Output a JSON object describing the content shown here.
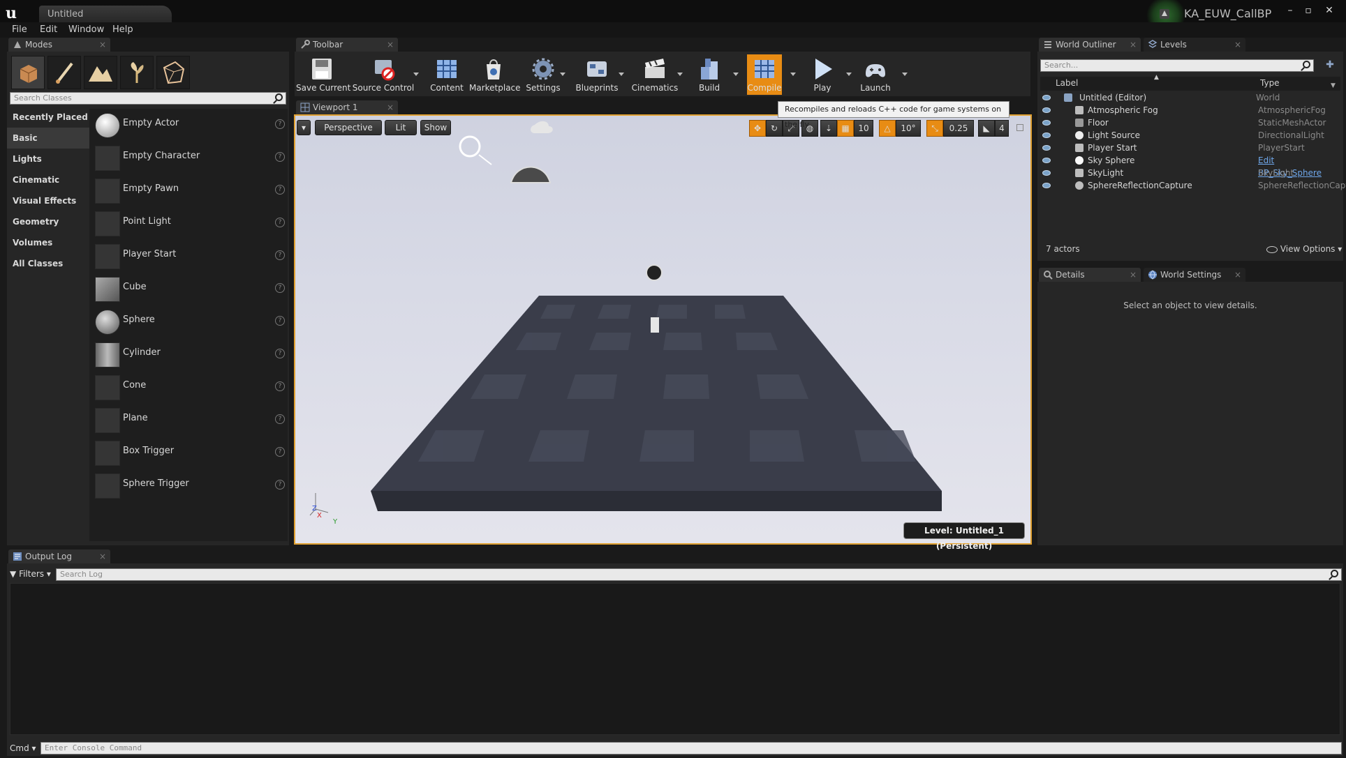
{
  "window": {
    "tab_title": "Untitled",
    "project_name": "KA_EUW_CallBP",
    "minimize": "–",
    "maximize": "▫",
    "close": "✕"
  },
  "menu": [
    "File",
    "Edit",
    "Window",
    "Help"
  ],
  "modes_panel": {
    "tab_label": "Modes",
    "mode_icons": [
      "place-mode-icon",
      "paint-mode-icon",
      "landscape-mode-icon",
      "foliage-mode-icon",
      "geometry-edit-mode-icon"
    ],
    "search_placeholder": "Search Classes",
    "categories": [
      "Recently Placed",
      "Basic",
      "Lights",
      "Cinematic",
      "Visual Effects",
      "Geometry",
      "Volumes",
      "All Classes"
    ],
    "active_category": "Basic",
    "items": [
      "Empty Actor",
      "Empty Character",
      "Empty Pawn",
      "Point Light",
      "Player Start",
      "Cube",
      "Sphere",
      "Cylinder",
      "Cone",
      "Plane",
      "Box Trigger",
      "Sphere Trigger"
    ],
    "help_glyph": "?"
  },
  "toolbar": {
    "tab_label": "Toolbar",
    "buttons": [
      {
        "label": "Save Current",
        "icon": "save-icon"
      },
      {
        "label": "Source Control",
        "icon": "source-control-icon"
      },
      {
        "label": "Content",
        "icon": "content-icon"
      },
      {
        "label": "Marketplace",
        "icon": "marketplace-icon"
      },
      {
        "label": "Settings",
        "icon": "settings-icon"
      },
      {
        "label": "Blueprints",
        "icon": "blueprints-icon"
      },
      {
        "label": "Cinematics",
        "icon": "cinematics-icon"
      },
      {
        "label": "Build",
        "icon": "build-icon"
      },
      {
        "label": "Compile",
        "icon": "compile-icon"
      },
      {
        "label": "Play",
        "icon": "play-icon"
      },
      {
        "label": "Launch",
        "icon": "launch-icon"
      }
    ],
    "tooltip": "Recompiles and reloads C++ code for game systems on the fly"
  },
  "viewport": {
    "tab_label": "Viewport 1",
    "perspective": "Perspective",
    "lit": "Lit",
    "show": "Show",
    "grid_snap": "10",
    "rotation_snap": "10°",
    "scale_snap": "0.25",
    "camera_speed": "4",
    "level_label": "Level:  Untitled_1 (Persistent)",
    "axis_labels": {
      "z": "Z",
      "x": "X",
      "y": "Y"
    },
    "accent": "#e88c14"
  },
  "world_outliner": {
    "tab_label": "World Outliner",
    "levels_tab": "Levels",
    "search_placeholder": "Search...",
    "columns": [
      "Label",
      "Type"
    ],
    "rows": [
      {
        "label": "Untitled (Editor)",
        "type": "World",
        "link": false
      },
      {
        "label": "Atmospheric Fog",
        "type": "AtmosphericFog",
        "link": false
      },
      {
        "label": "Floor",
        "type": "StaticMeshActor",
        "link": false
      },
      {
        "label": "Light Source",
        "type": "DirectionalLight",
        "link": false
      },
      {
        "label": "Player Start",
        "type": "PlayerStart",
        "link": false
      },
      {
        "label": "Sky Sphere",
        "type": "Edit BP_Sky_Sphere",
        "link": true
      },
      {
        "label": "SkyLight",
        "type": "SkyLight",
        "link": false
      },
      {
        "label": "SphereReflectionCapture",
        "type": "SphereReflectionCapt",
        "link": false
      }
    ],
    "actor_count": "7 actors",
    "view_options": "View Options"
  },
  "details": {
    "tab_label": "Details",
    "world_settings_tab": "World Settings",
    "empty_message": "Select an object to view details."
  },
  "output_log": {
    "tab_label": "Output Log",
    "filters": "Filters",
    "search_placeholder": "Search Log",
    "cmd_label": "Cmd",
    "console_placeholder": "Enter Console Command"
  }
}
